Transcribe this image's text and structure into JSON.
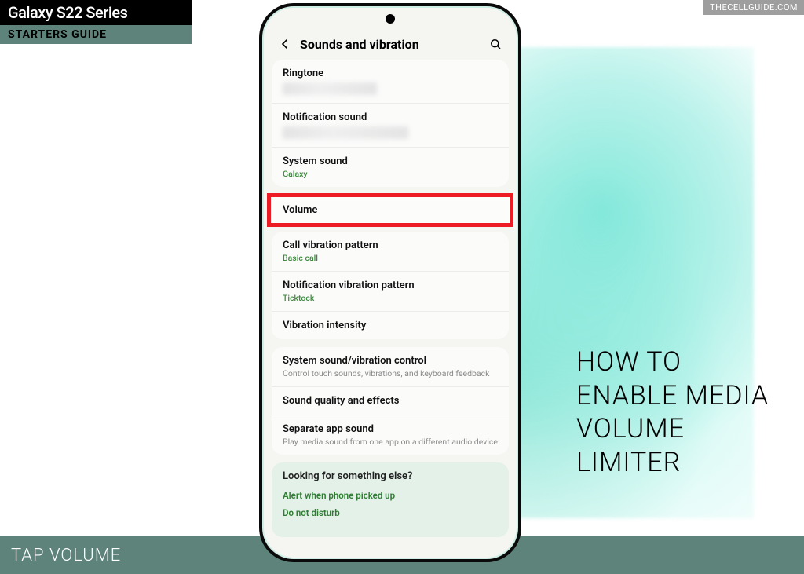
{
  "badge": {
    "top": "Galaxy S22 Series",
    "bottom": "STARTERS GUIDE"
  },
  "watermark": "THECELLGUIDE.COM",
  "footer": "TAP VOLUME",
  "headline": "HOW TO ENABLE MEDIA VOLUME LIMITER",
  "header": {
    "title": "Sounds and vibration"
  },
  "ringtone": {
    "label": "Ringtone"
  },
  "notification_sound": {
    "label": "Notification sound"
  },
  "system_sound": {
    "label": "System sound",
    "sub": "Galaxy"
  },
  "volume": {
    "label": "Volume"
  },
  "call_vib": {
    "label": "Call vibration pattern",
    "sub": "Basic call"
  },
  "notif_vib": {
    "label": "Notification vibration pattern",
    "sub": "Ticktock"
  },
  "vib_intensity": {
    "label": "Vibration intensity"
  },
  "sys_control": {
    "label": "System sound/vibration control",
    "sub": "Control touch sounds, vibrations, and keyboard feedback"
  },
  "sound_quality": {
    "label": "Sound quality and effects"
  },
  "separate_app": {
    "label": "Separate app sound",
    "sub": "Play media sound from one app on a different audio device"
  },
  "looking": {
    "title": "Looking for something else?",
    "link1": "Alert when phone picked up",
    "link2": "Do not disturb"
  }
}
